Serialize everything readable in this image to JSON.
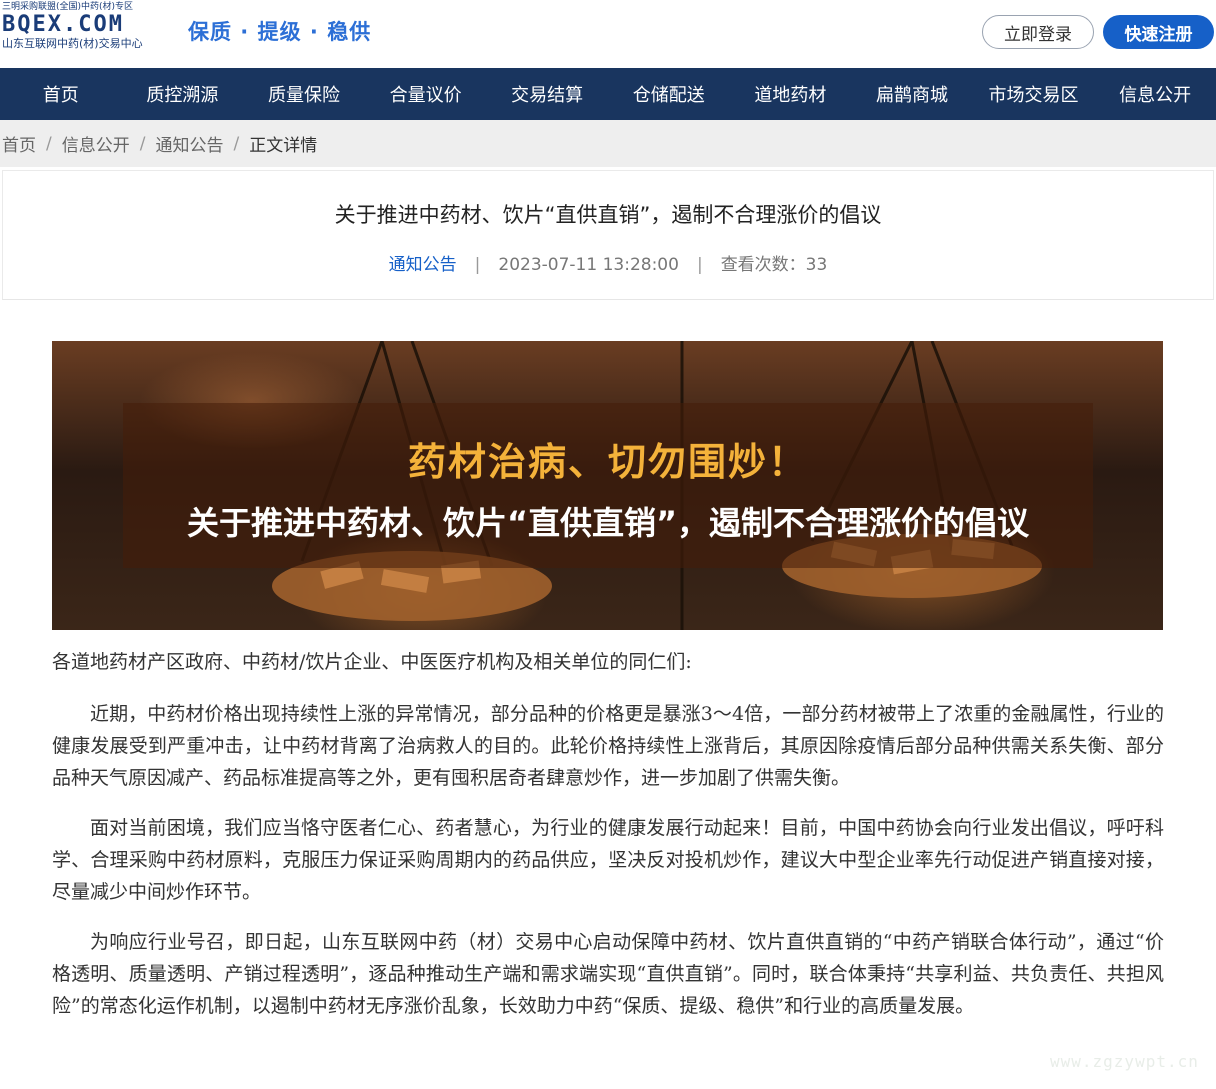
{
  "header": {
    "logo_tagline": "三明采购联盟(全国)中药(材)专区",
    "logo_brand": "BQEX.COM",
    "logo_sub": "山东互联网中药(材)交易中心",
    "slogan": "保质 · 提级 · 稳供",
    "login_label": "立即登录",
    "register_label": "快速注册"
  },
  "nav": {
    "items": [
      "首页",
      "质控溯源",
      "质量保险",
      "合量议价",
      "交易结算",
      "仓储配送",
      "道地药材",
      "扁鹊商城",
      "市场交易区",
      "信息公开"
    ]
  },
  "breadcrumb": {
    "items": [
      "首页",
      "信息公开",
      "通知公告"
    ],
    "current": "正文详情",
    "separator": "/"
  },
  "article": {
    "title": "关于推进中药材、饮片“直供直销”，遏制不合理涨价的倡议",
    "category": "通知公告",
    "datetime": "2023-07-11 13:28:00",
    "views_label": "查看次数：33",
    "banner_line1": "药材治病、切勿围炒！",
    "banner_line2": "关于推进中药材、饮片“直供直销”，遏制不合理涨价的倡议",
    "salutation": "各道地药材产区政府、中药材/饮片企业、中医医疗机构及相关单位的同仁们:",
    "paragraphs": [
      "近期，中药材价格出现持续性上涨的异常情况，部分品种的价格更是暴涨3～4倍，一部分药材被带上了浓重的金融属性，行业的健康发展受到严重冲击，让中药材背离了治病救人的目的。此轮价格持续性上涨背后，其原因除疫情后部分品种供需关系失衡、部分品种天气原因减产、药品标准提高等之外，更有囤积居奇者肆意炒作，进一步加剧了供需失衡。",
      "面对当前困境，我们应当恪守医者仁心、药者慧心，为行业的健康发展行动起来！目前，中国中药协会向行业发出倡议，呼吁科学、合理采购中药材原料，克服压力保证采购周期内的药品供应，坚决反对投机炒作，建议大中型企业率先行动促进产销直接对接，尽量减少中间炒作环节。",
      "为响应行业号召，即日起，山东互联网中药（材）交易中心启动保障中药材、饮片直供直销的“中药产销联合体行动”，通过“价格透明、质量透明、产销过程透明”，逐品种推动生产端和需求端实现“直供直销”。同时，联合体秉持“共享利益、共负责任、共担风险”的常态化运作机制，以遏制中药材无序涨价乱象，长效助力中药“保质、提级、稳供”和行业的高质量发展。"
    ]
  },
  "watermark": "www.zgzywpt.cn"
}
